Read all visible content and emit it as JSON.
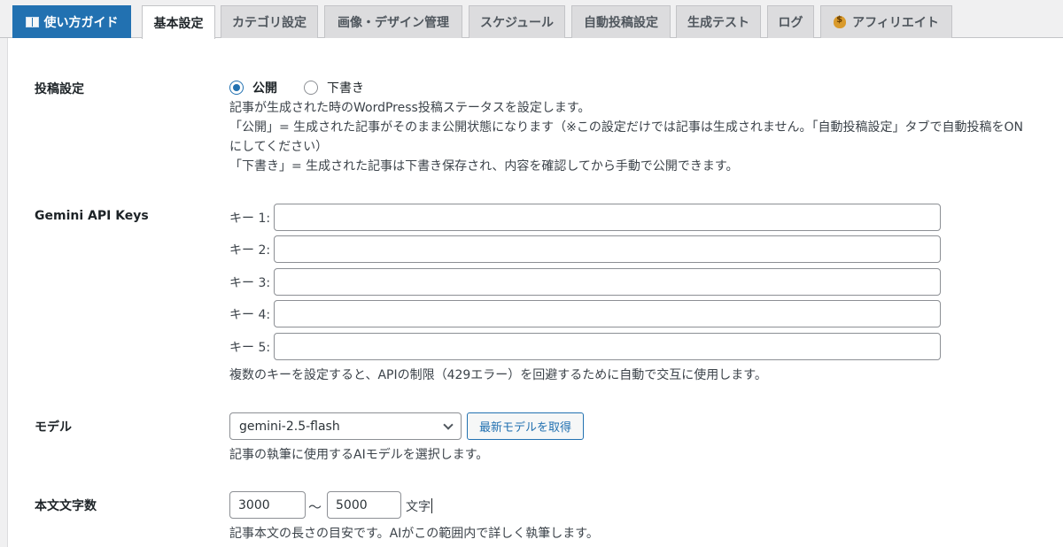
{
  "tabs": [
    {
      "label": "使い方ガイド",
      "icon": "book-icon"
    },
    {
      "label": "基本設定"
    },
    {
      "label": "カテゴリ設定"
    },
    {
      "label": "画像・デザイン管理"
    },
    {
      "label": "スケジュール"
    },
    {
      "label": "自動投稿設定"
    },
    {
      "label": "生成テスト"
    },
    {
      "label": "ログ"
    },
    {
      "label": "アフィリエイト",
      "icon": "money-bag-icon"
    }
  ],
  "post_settings": {
    "label": "投稿設定",
    "option_publish": "公開",
    "option_draft": "下書き",
    "desc_lines": [
      "記事が生成された時のWordPress投稿ステータスを設定します。",
      "「公開」= 生成された記事がそのまま公開状態になります（※この設定だけでは記事は生成されません。「自動投稿設定」タブで自動投稿をON",
      "にしてください）",
      "「下書き」= 生成された記事は下書き保存され、内容を確認してから手動で公開できます。"
    ]
  },
  "api_keys": {
    "label": "Gemini API Keys",
    "keys": [
      {
        "label": "キー 1:",
        "value": ""
      },
      {
        "label": "キー 2:",
        "value": ""
      },
      {
        "label": "キー 3:",
        "value": ""
      },
      {
        "label": "キー 4:",
        "value": ""
      },
      {
        "label": "キー 5:",
        "value": ""
      }
    ],
    "desc": "複数のキーを設定すると、APIの制限（429エラー）を回避するために自動で交互に使用します。"
  },
  "model": {
    "label": "モデル",
    "selected": "gemini-2.5-flash",
    "fetch_button": "最新モデルを取得",
    "desc": "記事の執筆に使用するAIモデルを選択します。"
  },
  "length": {
    "label": "本文文字数",
    "min": "3000",
    "separator": "〜",
    "max": "5000",
    "unit": "文字",
    "desc": "記事本文の長さの目安です。AIがこの範囲内で詳しく執筆します。"
  }
}
